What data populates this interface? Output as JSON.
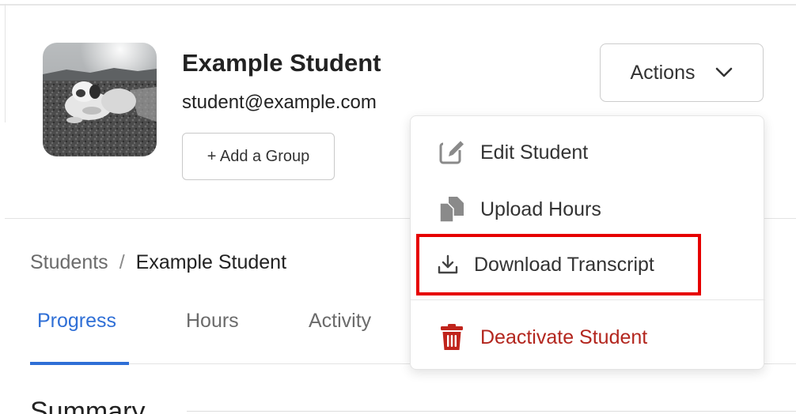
{
  "student": {
    "name": "Example Student",
    "email": "student@example.com"
  },
  "profile": {
    "add_group_label": "+ Add a Group"
  },
  "actions": {
    "button_label": "Actions",
    "menu": [
      {
        "label": "Edit Student",
        "icon": "edit-icon"
      },
      {
        "label": "Upload Hours",
        "icon": "copy-files-icon"
      },
      {
        "label": "Download Transcript",
        "icon": "download-icon"
      },
      {
        "label": "Deactivate Student",
        "icon": "trash-icon"
      }
    ]
  },
  "breadcrumb": {
    "parent": "Students",
    "separator": "/",
    "current": "Example Student"
  },
  "tabs": [
    {
      "label": "Progress",
      "active": true
    },
    {
      "label": "Hours",
      "active": false
    },
    {
      "label": "Activity",
      "active": false
    }
  ],
  "summary": {
    "heading": "Summary"
  },
  "colors": {
    "accent": "#2f6fd6",
    "danger": "#b3261e",
    "highlight": "#e60000",
    "icon_gray": "#8a8a8a"
  }
}
